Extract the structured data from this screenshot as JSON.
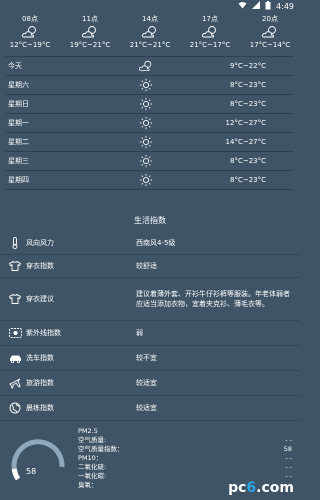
{
  "status_bar": {
    "time": "4:49"
  },
  "hourly": [
    {
      "time": "08点",
      "icon": "partly-cloudy-icon",
      "temp": "12°C~19°C"
    },
    {
      "time": "11点",
      "icon": "partly-cloudy-icon",
      "temp": "19°C~21°C"
    },
    {
      "time": "14点",
      "icon": "partly-cloudy-icon",
      "temp": "21°C~21°C"
    },
    {
      "time": "17点",
      "icon": "partly-cloudy-icon",
      "temp": "21°C~17°C"
    },
    {
      "time": "20点",
      "icon": "partly-cloudy-icon",
      "temp": "17°C~14°C"
    }
  ],
  "daily": [
    {
      "name": "今天",
      "icon": "partly-cloudy-icon",
      "temp": "9°C~22°C"
    },
    {
      "name": "星期六",
      "icon": "sun-icon",
      "temp": "8°C~23°C"
    },
    {
      "name": "星期日",
      "icon": "sun-icon",
      "temp": "8°C~23°C"
    },
    {
      "name": "星期一",
      "icon": "sun-icon",
      "temp": "12°C~27°C"
    },
    {
      "name": "星期二",
      "icon": "sun-icon",
      "temp": "14°C~27°C"
    },
    {
      "name": "星期三",
      "icon": "sun-icon",
      "temp": "8°C~23°C"
    },
    {
      "name": "星期四",
      "icon": "sun-icon",
      "temp": "8°C~23°C"
    }
  ],
  "life": {
    "title": "生活指数",
    "items": [
      {
        "icon": "thermometer-icon",
        "label": "风向风力",
        "value": "西南风4-5级"
      },
      {
        "icon": "shirt-icon",
        "label": "穿衣指数",
        "value": "较舒适"
      },
      {
        "icon": "shirt-icon",
        "label": "穿衣建议",
        "value": "建议着薄外套、开衫牛仔衫裤等服装。年老体弱者应适当添加衣物，宜着夹克衫、薄毛衣等。"
      },
      {
        "icon": "uv-icon",
        "label": "紫外线指数",
        "value": "弱"
      },
      {
        "icon": "car-icon",
        "label": "洗车指数",
        "value": "较不宜"
      },
      {
        "icon": "plane-icon",
        "label": "旅游指数",
        "value": "较适宜"
      },
      {
        "icon": "globe-icon",
        "label": "晨练指数",
        "value": "较适宜"
      }
    ]
  },
  "aqi": {
    "value": "58",
    "level_fraction": 0.12,
    "rows": [
      {
        "label": "PM2.5",
        "value": ""
      },
      {
        "label": "空气质量:",
        "value": "- -"
      },
      {
        "label": "空气质量指数：",
        "value": "58"
      },
      {
        "label": "PM10：",
        "value": "- -"
      },
      {
        "label": "二氧化硫:",
        "value": "- -"
      },
      {
        "label": "一氧化碳:",
        "value": "- -"
      },
      {
        "label": "臭氧：",
        "value": "- -"
      }
    ]
  },
  "watermark": {
    "part1": "pc",
    "part2": "6",
    "part3": ".com"
  },
  "colors": {
    "background": "#3f5466",
    "gauge": "#8fa8bc",
    "watermark_accent": "#2aa7e6"
  }
}
